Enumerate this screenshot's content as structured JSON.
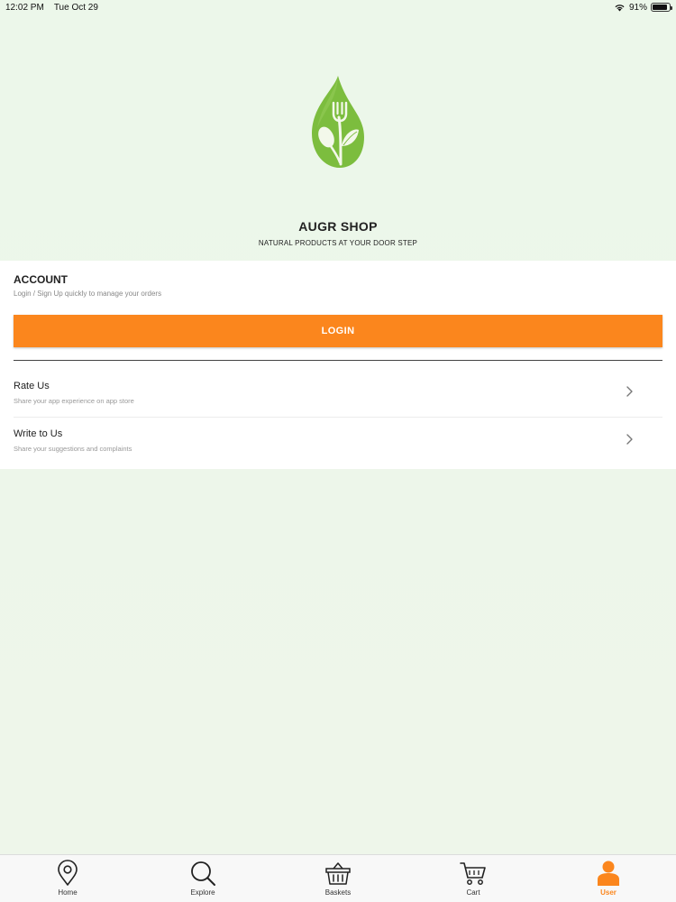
{
  "status_bar": {
    "time": "12:02 PM",
    "date": "Tue Oct 29",
    "battery": "91%",
    "battery_level": 0.91
  },
  "brand": {
    "name": "AUGR SHOP",
    "tagline": "NATURAL PRODUCTS AT YOUR DOOR STEP",
    "logo_color": "#7cbd3e"
  },
  "account": {
    "title": "ACCOUNT",
    "subtitle": "Login / Sign Up quickly to manage your orders",
    "login_label": "LOGIN",
    "accent": "#fb861d"
  },
  "menu": [
    {
      "title": "Rate Us",
      "subtitle": "Share your app experience on app store",
      "icon": "chevron-right-icon"
    },
    {
      "title": "Write to Us",
      "subtitle": "Share your suggestions and complaints",
      "icon": "chevron-right-icon"
    }
  ],
  "tabs": [
    {
      "label": "Home",
      "icon": "map-pin-icon",
      "active": false
    },
    {
      "label": "Explore",
      "icon": "search-icon",
      "active": false
    },
    {
      "label": "Baskets",
      "icon": "basket-icon",
      "active": false
    },
    {
      "label": "Cart",
      "icon": "cart-icon",
      "active": false
    },
    {
      "label": "User",
      "icon": "user-icon",
      "active": true
    }
  ]
}
